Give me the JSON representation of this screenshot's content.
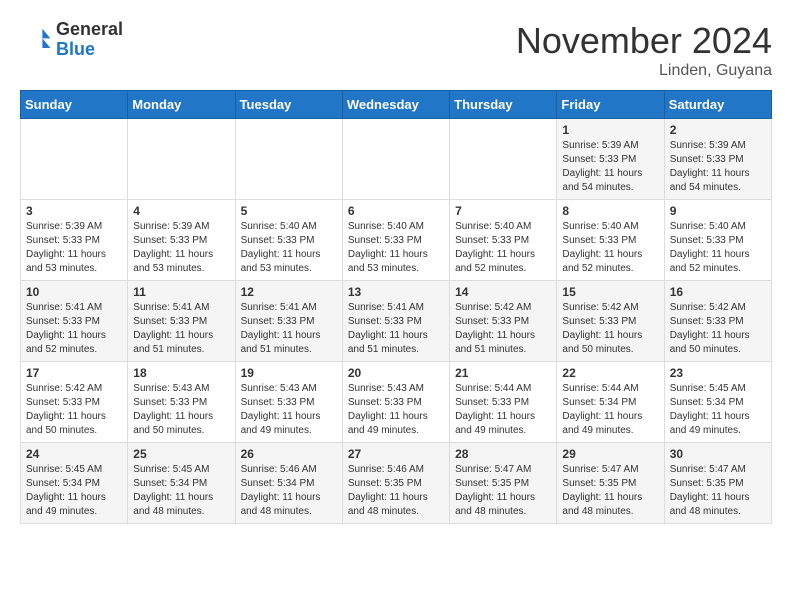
{
  "logo": {
    "general": "General",
    "blue": "Blue"
  },
  "header": {
    "month": "November 2024",
    "location": "Linden, Guyana"
  },
  "weekdays": [
    "Sunday",
    "Monday",
    "Tuesday",
    "Wednesday",
    "Thursday",
    "Friday",
    "Saturday"
  ],
  "weeks": [
    [
      {
        "day": "",
        "info": ""
      },
      {
        "day": "",
        "info": ""
      },
      {
        "day": "",
        "info": ""
      },
      {
        "day": "",
        "info": ""
      },
      {
        "day": "",
        "info": ""
      },
      {
        "day": "1",
        "info": "Sunrise: 5:39 AM\nSunset: 5:33 PM\nDaylight: 11 hours\nand 54 minutes."
      },
      {
        "day": "2",
        "info": "Sunrise: 5:39 AM\nSunset: 5:33 PM\nDaylight: 11 hours\nand 54 minutes."
      }
    ],
    [
      {
        "day": "3",
        "info": "Sunrise: 5:39 AM\nSunset: 5:33 PM\nDaylight: 11 hours\nand 53 minutes."
      },
      {
        "day": "4",
        "info": "Sunrise: 5:39 AM\nSunset: 5:33 PM\nDaylight: 11 hours\nand 53 minutes."
      },
      {
        "day": "5",
        "info": "Sunrise: 5:40 AM\nSunset: 5:33 PM\nDaylight: 11 hours\nand 53 minutes."
      },
      {
        "day": "6",
        "info": "Sunrise: 5:40 AM\nSunset: 5:33 PM\nDaylight: 11 hours\nand 53 minutes."
      },
      {
        "day": "7",
        "info": "Sunrise: 5:40 AM\nSunset: 5:33 PM\nDaylight: 11 hours\nand 52 minutes."
      },
      {
        "day": "8",
        "info": "Sunrise: 5:40 AM\nSunset: 5:33 PM\nDaylight: 11 hours\nand 52 minutes."
      },
      {
        "day": "9",
        "info": "Sunrise: 5:40 AM\nSunset: 5:33 PM\nDaylight: 11 hours\nand 52 minutes."
      }
    ],
    [
      {
        "day": "10",
        "info": "Sunrise: 5:41 AM\nSunset: 5:33 PM\nDaylight: 11 hours\nand 52 minutes."
      },
      {
        "day": "11",
        "info": "Sunrise: 5:41 AM\nSunset: 5:33 PM\nDaylight: 11 hours\nand 51 minutes."
      },
      {
        "day": "12",
        "info": "Sunrise: 5:41 AM\nSunset: 5:33 PM\nDaylight: 11 hours\nand 51 minutes."
      },
      {
        "day": "13",
        "info": "Sunrise: 5:41 AM\nSunset: 5:33 PM\nDaylight: 11 hours\nand 51 minutes."
      },
      {
        "day": "14",
        "info": "Sunrise: 5:42 AM\nSunset: 5:33 PM\nDaylight: 11 hours\nand 51 minutes."
      },
      {
        "day": "15",
        "info": "Sunrise: 5:42 AM\nSunset: 5:33 PM\nDaylight: 11 hours\nand 50 minutes."
      },
      {
        "day": "16",
        "info": "Sunrise: 5:42 AM\nSunset: 5:33 PM\nDaylight: 11 hours\nand 50 minutes."
      }
    ],
    [
      {
        "day": "17",
        "info": "Sunrise: 5:42 AM\nSunset: 5:33 PM\nDaylight: 11 hours\nand 50 minutes."
      },
      {
        "day": "18",
        "info": "Sunrise: 5:43 AM\nSunset: 5:33 PM\nDaylight: 11 hours\nand 50 minutes."
      },
      {
        "day": "19",
        "info": "Sunrise: 5:43 AM\nSunset: 5:33 PM\nDaylight: 11 hours\nand 49 minutes."
      },
      {
        "day": "20",
        "info": "Sunrise: 5:43 AM\nSunset: 5:33 PM\nDaylight: 11 hours\nand 49 minutes."
      },
      {
        "day": "21",
        "info": "Sunrise: 5:44 AM\nSunset: 5:33 PM\nDaylight: 11 hours\nand 49 minutes."
      },
      {
        "day": "22",
        "info": "Sunrise: 5:44 AM\nSunset: 5:34 PM\nDaylight: 11 hours\nand 49 minutes."
      },
      {
        "day": "23",
        "info": "Sunrise: 5:45 AM\nSunset: 5:34 PM\nDaylight: 11 hours\nand 49 minutes."
      }
    ],
    [
      {
        "day": "24",
        "info": "Sunrise: 5:45 AM\nSunset: 5:34 PM\nDaylight: 11 hours\nand 49 minutes."
      },
      {
        "day": "25",
        "info": "Sunrise: 5:45 AM\nSunset: 5:34 PM\nDaylight: 11 hours\nand 48 minutes."
      },
      {
        "day": "26",
        "info": "Sunrise: 5:46 AM\nSunset: 5:34 PM\nDaylight: 11 hours\nand 48 minutes."
      },
      {
        "day": "27",
        "info": "Sunrise: 5:46 AM\nSunset: 5:35 PM\nDaylight: 11 hours\nand 48 minutes."
      },
      {
        "day": "28",
        "info": "Sunrise: 5:47 AM\nSunset: 5:35 PM\nDaylight: 11 hours\nand 48 minutes."
      },
      {
        "day": "29",
        "info": "Sunrise: 5:47 AM\nSunset: 5:35 PM\nDaylight: 11 hours\nand 48 minutes."
      },
      {
        "day": "30",
        "info": "Sunrise: 5:47 AM\nSunset: 5:35 PM\nDaylight: 11 hours\nand 48 minutes."
      }
    ]
  ]
}
